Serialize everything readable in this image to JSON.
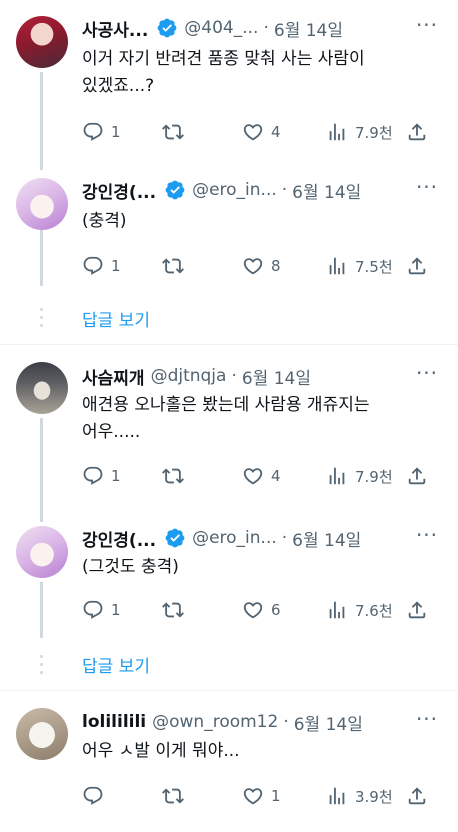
{
  "tweets": [
    {
      "name": "사공사...",
      "verified": true,
      "handle": "@404_...",
      "separator": "·",
      "date": "6월 14일",
      "more": "···",
      "text": "이거 자기 반려견 품종 맞춰 사는 사람이\n있겠죠...?",
      "replies": "1",
      "retweets": "",
      "likes": "4",
      "views": "7.9천"
    },
    {
      "name": "강인경(...",
      "verified": true,
      "handle": "@ero_in...",
      "separator": "·",
      "date": "6월 14일",
      "more": "···",
      "text": "(충격)",
      "replies": "1",
      "retweets": "",
      "likes": "8",
      "views": "7.5천"
    },
    {
      "name": "사슴찌개",
      "verified": false,
      "handle": "@djtnqja",
      "separator": "·",
      "date": "6월 14일",
      "more": "···",
      "text": "애견용 오나홀은 봤는데 사람용 개쥬지는\n어우.....",
      "replies": "1",
      "retweets": "",
      "likes": "4",
      "views": "7.9천"
    },
    {
      "name": "강인경(...",
      "verified": true,
      "handle": "@ero_in...",
      "separator": "·",
      "date": "6월 14일",
      "more": "···",
      "text": "(그것도 충격)",
      "replies": "1",
      "retweets": "",
      "likes": "6",
      "views": "7.6천"
    },
    {
      "name": "lolililili",
      "verified": false,
      "handle": "@own_room12",
      "separator": "·",
      "date": "6월 14일",
      "more": "···",
      "text": "어우 ㅅ발 이게 뭐야...",
      "replies": "",
      "retweets": "",
      "likes": "1",
      "views": "3.9천"
    }
  ],
  "show_replies_label_1": "답글 보기",
  "show_replies_label_2": "답글 보기",
  "colors": {
    "accent": "#1d9bf0",
    "secondary_text": "#536471",
    "thread_line": "#cfd9de"
  },
  "icons": [
    "reply-icon",
    "retweet-icon",
    "like-icon",
    "views-icon",
    "share-icon",
    "verified-badge-icon",
    "more-icon"
  ]
}
